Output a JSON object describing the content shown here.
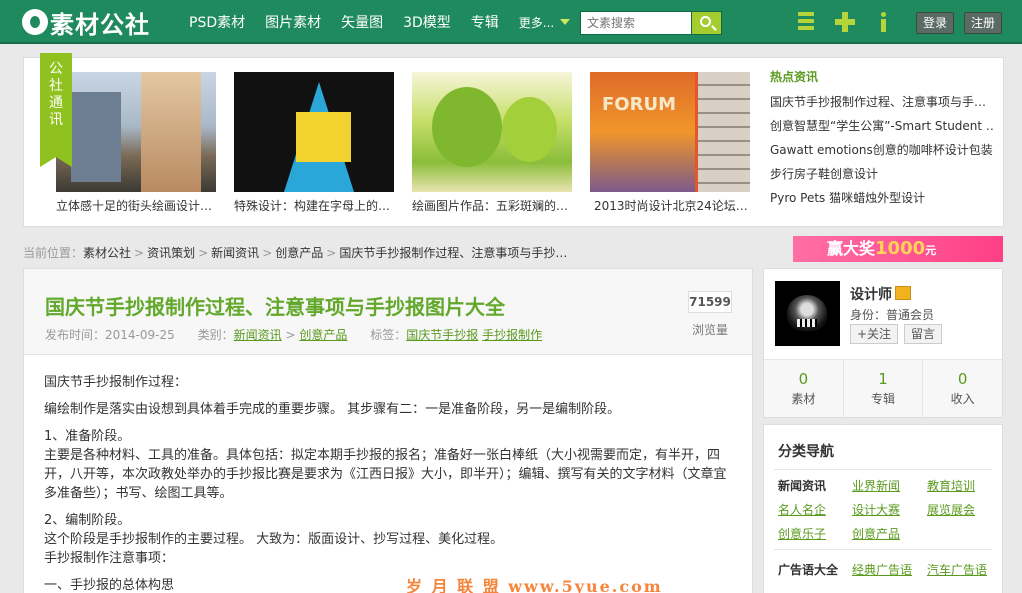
{
  "header": {
    "logo_text": "素材公社",
    "nav": [
      "PSD素材",
      "图片素材",
      "矢量图",
      "3D模型",
      "专辑"
    ],
    "more_label": "更多...",
    "search_placeholder": "文素搜索",
    "login_label": "登录",
    "register_label": "注册",
    "icons": [
      "list-icon",
      "plus-icon",
      "info-icon"
    ],
    "colors": {
      "bar": "#1e8a5e",
      "accent": "#a4cc2f"
    }
  },
  "strip": {
    "ribbon": [
      "公",
      "社",
      "通",
      "讯"
    ],
    "thumb_overlay_text": "FORUM",
    "captions": [
      "立体感十足的街头绘画设计…",
      "特殊设计：构建在字母上的…",
      "绘画图片作品：五彩斑斓的…",
      "2013时尚设计北京24论坛…"
    ],
    "hot_title": "热点资讯",
    "hot_items": [
      "国庆节手抄报制作过程、注意事项与手…",
      "创意智慧型“学生公寓”-Smart Student …",
      "Gawatt emotions创意的咖啡杯设计包装",
      "步行房子鞋创意设计",
      "Pyro Pets 猫咪蜡烛外型设计"
    ]
  },
  "breadcrumb": {
    "prefix": "当前位置：",
    "items": [
      "素材公社",
      "资讯策划",
      "新闻资讯",
      "创意产品",
      "国庆节手抄报制作过程、注意事项与手抄…"
    ],
    "separator": ">"
  },
  "banner": {
    "text": "赢大奖",
    "amount": "1000",
    "unit": "元"
  },
  "article": {
    "title": "国庆节手抄报制作过程、注意事项与手抄报图片大全",
    "date_label": "发布时间：",
    "date": "2014-09-25",
    "category_label": "类别：",
    "category_1": "新闻资讯",
    "category_2": "创意产品",
    "tags_label": "标签：",
    "tag_1": "国庆节手抄报",
    "tag_2": "手抄报制作",
    "views": "71599",
    "views_label": "浏览量",
    "body": [
      "国庆节手抄报制作过程：",
      "编绘制作是落实由设想到具体着手完成的重要步骤。 其步骤有二：一是准备阶段，另一是编制阶段。",
      "1、准备阶段。",
      "主要是各种材料、工具的准备。具体包括：拟定本期手抄报的报名；准备好一张白棒纸（大小视需要而定，有半开，四开，八开等，本次政教处举办的手抄报比赛是要求为《江西日报》大小，即半开）；编辑、撰写有关的文字材料（文章宜多准备些）；书写、绘图工具等。",
      "2、编制阶段。",
      "这个阶段是手抄报制作的主要过程。 大致为：版面设计、抄写过程、美化过程。",
      "手抄报制作注意事项：",
      "一、手抄报的总体构思"
    ],
    "watermark": "岁 月 联 盟  www.5yue.com"
  },
  "author": {
    "name": "设计师",
    "role_label": "身份：",
    "role": "普通会员",
    "follow_label": "+关注",
    "message_label": "留言",
    "stats": [
      {
        "num": "0",
        "label": "素材"
      },
      {
        "num": "1",
        "label": "专辑"
      },
      {
        "num": "0",
        "label": "收入"
      }
    ]
  },
  "category_nav": {
    "title": "分类导航",
    "row1": {
      "head": "新闻资讯",
      "links": [
        "业界新闻",
        "教育培训"
      ]
    },
    "row2": {
      "links": [
        "名人名企",
        "设计大赛",
        "展览展会"
      ]
    },
    "row3": {
      "links": [
        "创意乐子",
        "创意产品"
      ]
    },
    "row4": {
      "head": "广告语大全",
      "links": [
        "经典广告语",
        "汽车广告语"
      ]
    }
  }
}
